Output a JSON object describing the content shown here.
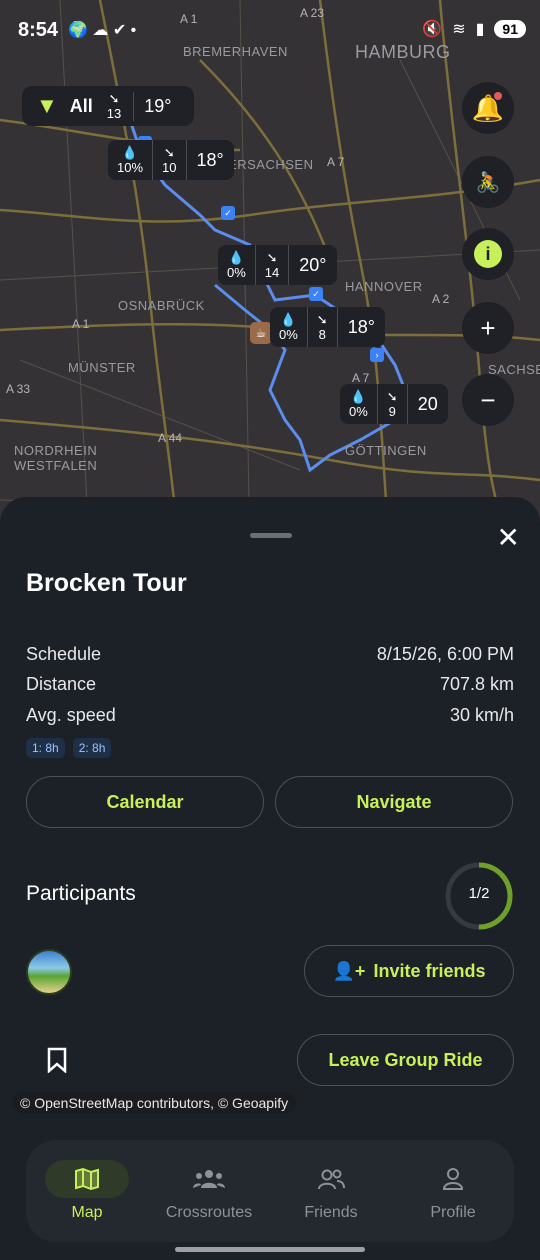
{
  "status_bar": {
    "time": "8:54",
    "battery": "91"
  },
  "map": {
    "labels": [
      "BREMERHAVEN",
      "HAMBURG",
      "NIEDERSACHSEN",
      "HANNOVER",
      "OSNABRÜCK",
      "MÜNSTER",
      "NORDRHEIN",
      "WESTFALEN",
      "GÖTTINGEN",
      "SACHSE"
    ],
    "highways": [
      "A 23",
      "A 7",
      "A 2",
      "A 1",
      "A 33",
      "A 44",
      "A 7",
      "A 1"
    ],
    "filter": {
      "label": "All",
      "wind": "13",
      "temp": "19°"
    },
    "weather_markers": [
      {
        "rain": "10%",
        "wind": "10",
        "temp": "18°"
      },
      {
        "rain": "0%",
        "wind": "14",
        "temp": "20°"
      },
      {
        "rain": "0%",
        "wind": "8",
        "temp": "18°"
      },
      {
        "rain": "0%",
        "wind": "9",
        "temp": "20"
      }
    ]
  },
  "tour": {
    "title": "Brocken Tour",
    "rows": [
      {
        "label": "Schedule",
        "value": "8/15/26, 6:00 PM"
      },
      {
        "label": "Distance",
        "value": "707.8 km"
      },
      {
        "label": "Avg. speed",
        "value": "30 km/h"
      }
    ],
    "chips": [
      "1: 8h",
      "2: 8h"
    ],
    "calendar_label": "Calendar",
    "navigate_label": "Navigate",
    "participants_label": "Participants",
    "participants_count": "1/2",
    "participants_fraction": 0.5,
    "invite_label": "Invite friends",
    "leave_label": "Leave Group Ride"
  },
  "attribution": "© OpenStreetMap contributors, © Geoapify",
  "nav": [
    {
      "label": "Map",
      "icon": "map-icon"
    },
    {
      "label": "Crossroutes",
      "icon": "group-icon"
    },
    {
      "label": "Friends",
      "icon": "friends-icon"
    },
    {
      "label": "Profile",
      "icon": "person-icon"
    }
  ],
  "colors": {
    "accent": "#c8f05a",
    "route": "#5b8def",
    "sheet": "#1c2128"
  }
}
